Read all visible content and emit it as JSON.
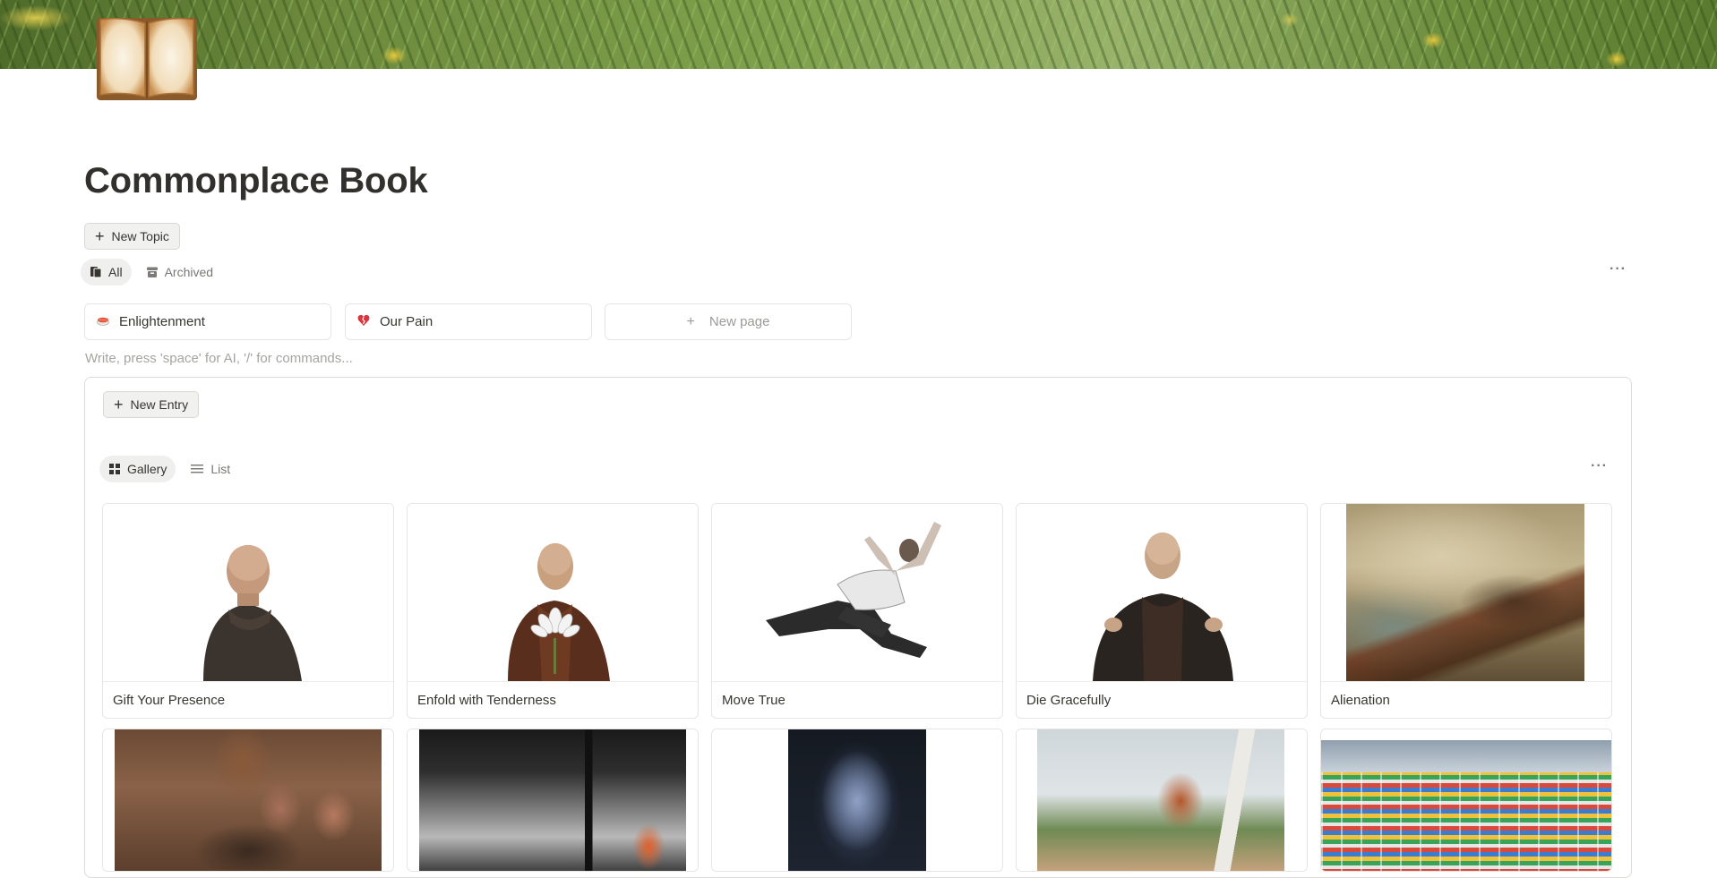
{
  "page": {
    "title": "Commonplace Book",
    "new_topic_label": "New Topic",
    "tabs": [
      {
        "label": "All",
        "icon": "books-icon",
        "active": true
      },
      {
        "label": "Archived",
        "icon": "archive-box-icon",
        "active": false
      }
    ],
    "more_label": "···",
    "linked_pages": [
      {
        "label": "Enlightenment",
        "icon": "sushi-emoji-icon"
      },
      {
        "label": "Our Pain",
        "icon": "broken-heart-icon"
      }
    ],
    "new_page_label": "New page",
    "editor_placeholder": "Write, press 'space' for AI, '/' for commands..."
  },
  "database": {
    "new_entry_label": "New Entry",
    "views": [
      {
        "label": "Gallery",
        "icon": "gallery-grid-icon",
        "active": true
      },
      {
        "label": "List",
        "icon": "list-lines-icon",
        "active": false
      }
    ],
    "more_label": "···",
    "cards": [
      {
        "title": "Gift Your Presence",
        "image": "seated-monk-photo"
      },
      {
        "title": "Enfold with Tenderness",
        "image": "monk-with-lotus-photo"
      },
      {
        "title": "Move True",
        "image": "flying-kick-photo"
      },
      {
        "title": "Die Gracefully",
        "image": "seated-monk-gesturing-photo"
      },
      {
        "title": "Alienation",
        "image": "turner-rain-steam-speed-painting"
      }
    ],
    "row2_images": [
      "family-meal-photo",
      "street-scene-photo",
      "blue-head-sculpture-painting",
      "orangutan-on-tree-photo",
      "supermarket-aisles-photo"
    ]
  }
}
